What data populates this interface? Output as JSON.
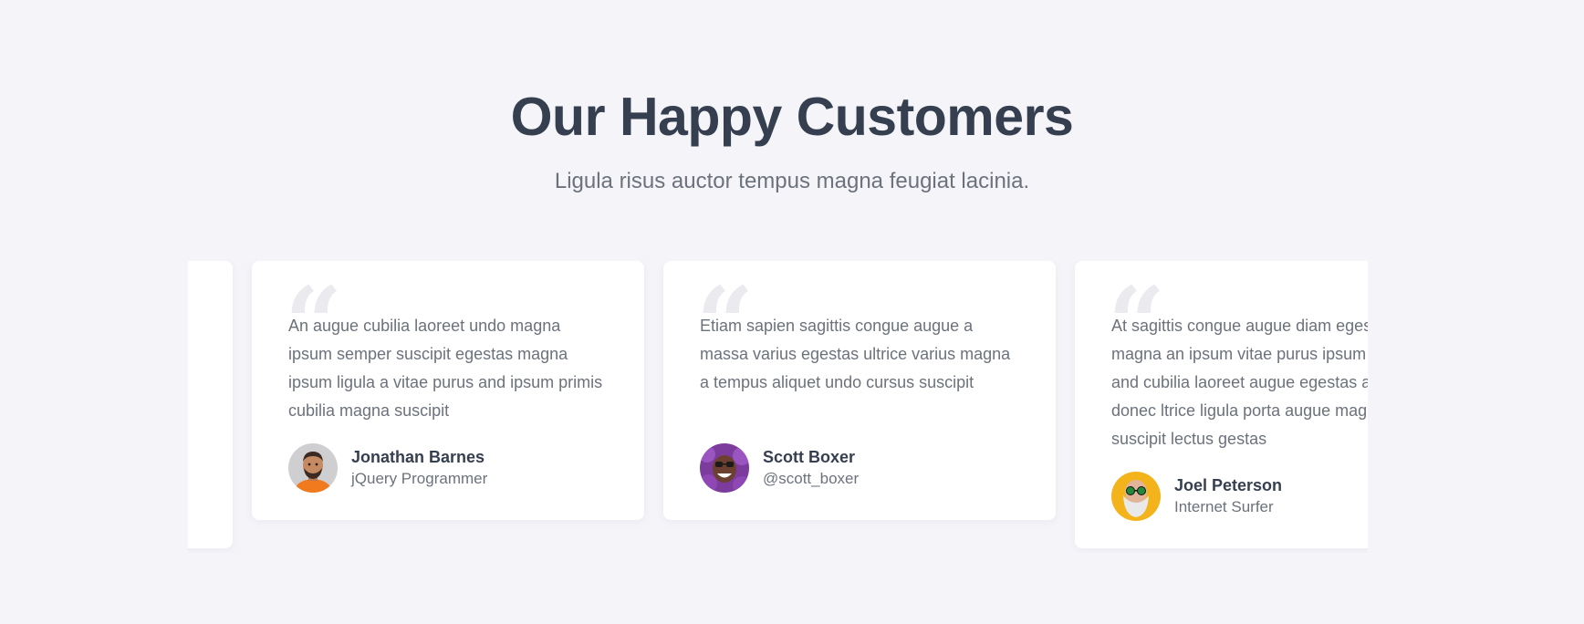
{
  "section": {
    "title": "Our Happy Customers",
    "subtitle": "Ligula risus auctor tempus magna feugiat lacinia."
  },
  "testimonials": [
    {
      "quote_glyph": "“",
      "text": "An augue cubilia laoreet undo magna ipsum semper suscipit egestas magna ipsum ligula a vitae purus and ipsum primis cubilia magna suscipit",
      "name": "Jonathan Barnes",
      "role": "jQuery Programmer"
    },
    {
      "quote_glyph": "“",
      "text": "Etiam sapien sagittis congue augue a massa varius egestas ultrice varius magna a tempus aliquet undo cursus suscipit",
      "name": "Scott Boxer",
      "role": "@scott_boxer"
    },
    {
      "quote_glyph": "“",
      "text": "At sagittis congue augue diam egestas magna an ipsum vitae purus ipsum primis and cubilia laoreet augue egestas a luctus donec ltrice ligula porta augue magna suscipit lectus gestas",
      "name": "Joel Peterson",
      "role": "Internet Surfer"
    }
  ],
  "colors": {
    "background": "#f4f4f9",
    "card": "#ffffff",
    "heading": "#353f4f",
    "body_text": "#6c727c",
    "quote_mark": "#ebebef"
  }
}
